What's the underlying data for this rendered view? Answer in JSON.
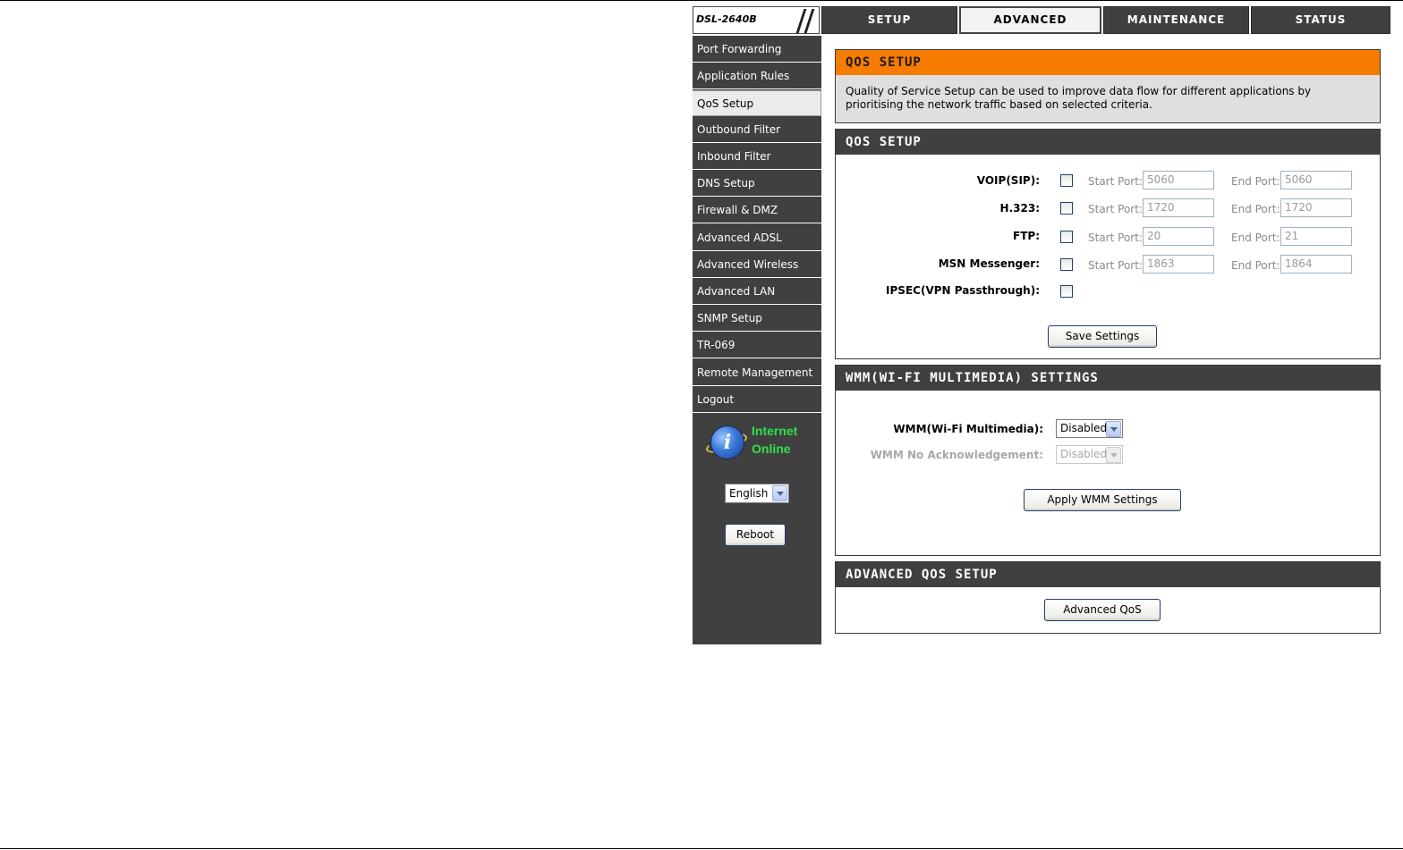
{
  "header": {
    "model": "DSL-2640B",
    "tabs": [
      {
        "label": "SETUP"
      },
      {
        "label": "ADVANCED"
      },
      {
        "label": "MAINTENANCE"
      },
      {
        "label": "STATUS"
      }
    ],
    "active_tab": "ADVANCED"
  },
  "sidebar": {
    "items": [
      {
        "label": "Port Forwarding"
      },
      {
        "label": "Application Rules"
      },
      {
        "label": "QoS Setup"
      },
      {
        "label": "Outbound Filter"
      },
      {
        "label": "Inbound Filter"
      },
      {
        "label": "DNS Setup"
      },
      {
        "label": "Firewall & DMZ"
      },
      {
        "label": "Advanced ADSL"
      },
      {
        "label": "Advanced Wireless"
      },
      {
        "label": "Advanced LAN"
      },
      {
        "label": "SNMP Setup"
      },
      {
        "label": "TR-069"
      },
      {
        "label": "Remote Management"
      },
      {
        "label": "Logout"
      }
    ],
    "active_item": "QoS Setup",
    "status": {
      "line1": "Internet",
      "line2": "Online",
      "color": "#2fe04a"
    },
    "language": "English",
    "reboot_label": "Reboot"
  },
  "info_panel": {
    "title": "QOS SETUP",
    "description": "Quality of Service Setup can be used to improve data flow for different applications by prioritising the network traffic based on selected criteria.",
    "accent": "#f57c00"
  },
  "qos_panel": {
    "title": "QOS SETUP",
    "rows": [
      {
        "label": "VOIP(SIP):",
        "checked": false,
        "start_label": "Start Port:",
        "start": "5060",
        "end_label": "End Port:",
        "end": "5060"
      },
      {
        "label": "H.323:",
        "checked": false,
        "start_label": "Start Port:",
        "start": "1720",
        "end_label": "End Port:",
        "end": "1720"
      },
      {
        "label": "FTP:",
        "checked": false,
        "start_label": "Start Port:",
        "start": "20",
        "end_label": "End Port:",
        "end": "21"
      },
      {
        "label": "MSN Messenger:",
        "checked": false,
        "start_label": "Start Port:",
        "start": "1863",
        "end_label": "End Port:",
        "end": "1864"
      },
      {
        "label": "IPSEC(VPN Passthrough):",
        "checked": false
      }
    ],
    "save_label": "Save Settings"
  },
  "wmm_panel": {
    "title": "WMM(WI-FI MULTIMEDIA) SETTINGS",
    "wmm_label": "WMM(Wi-Fi Multimedia):",
    "wmm_value": "Disabled",
    "noack_label": "WMM No Acknowledgement:",
    "noack_value": "Disabled",
    "apply_label": "Apply WMM Settings"
  },
  "advanced_panel": {
    "title": "ADVANCED QOS SETUP",
    "button_label": "Advanced QoS"
  }
}
